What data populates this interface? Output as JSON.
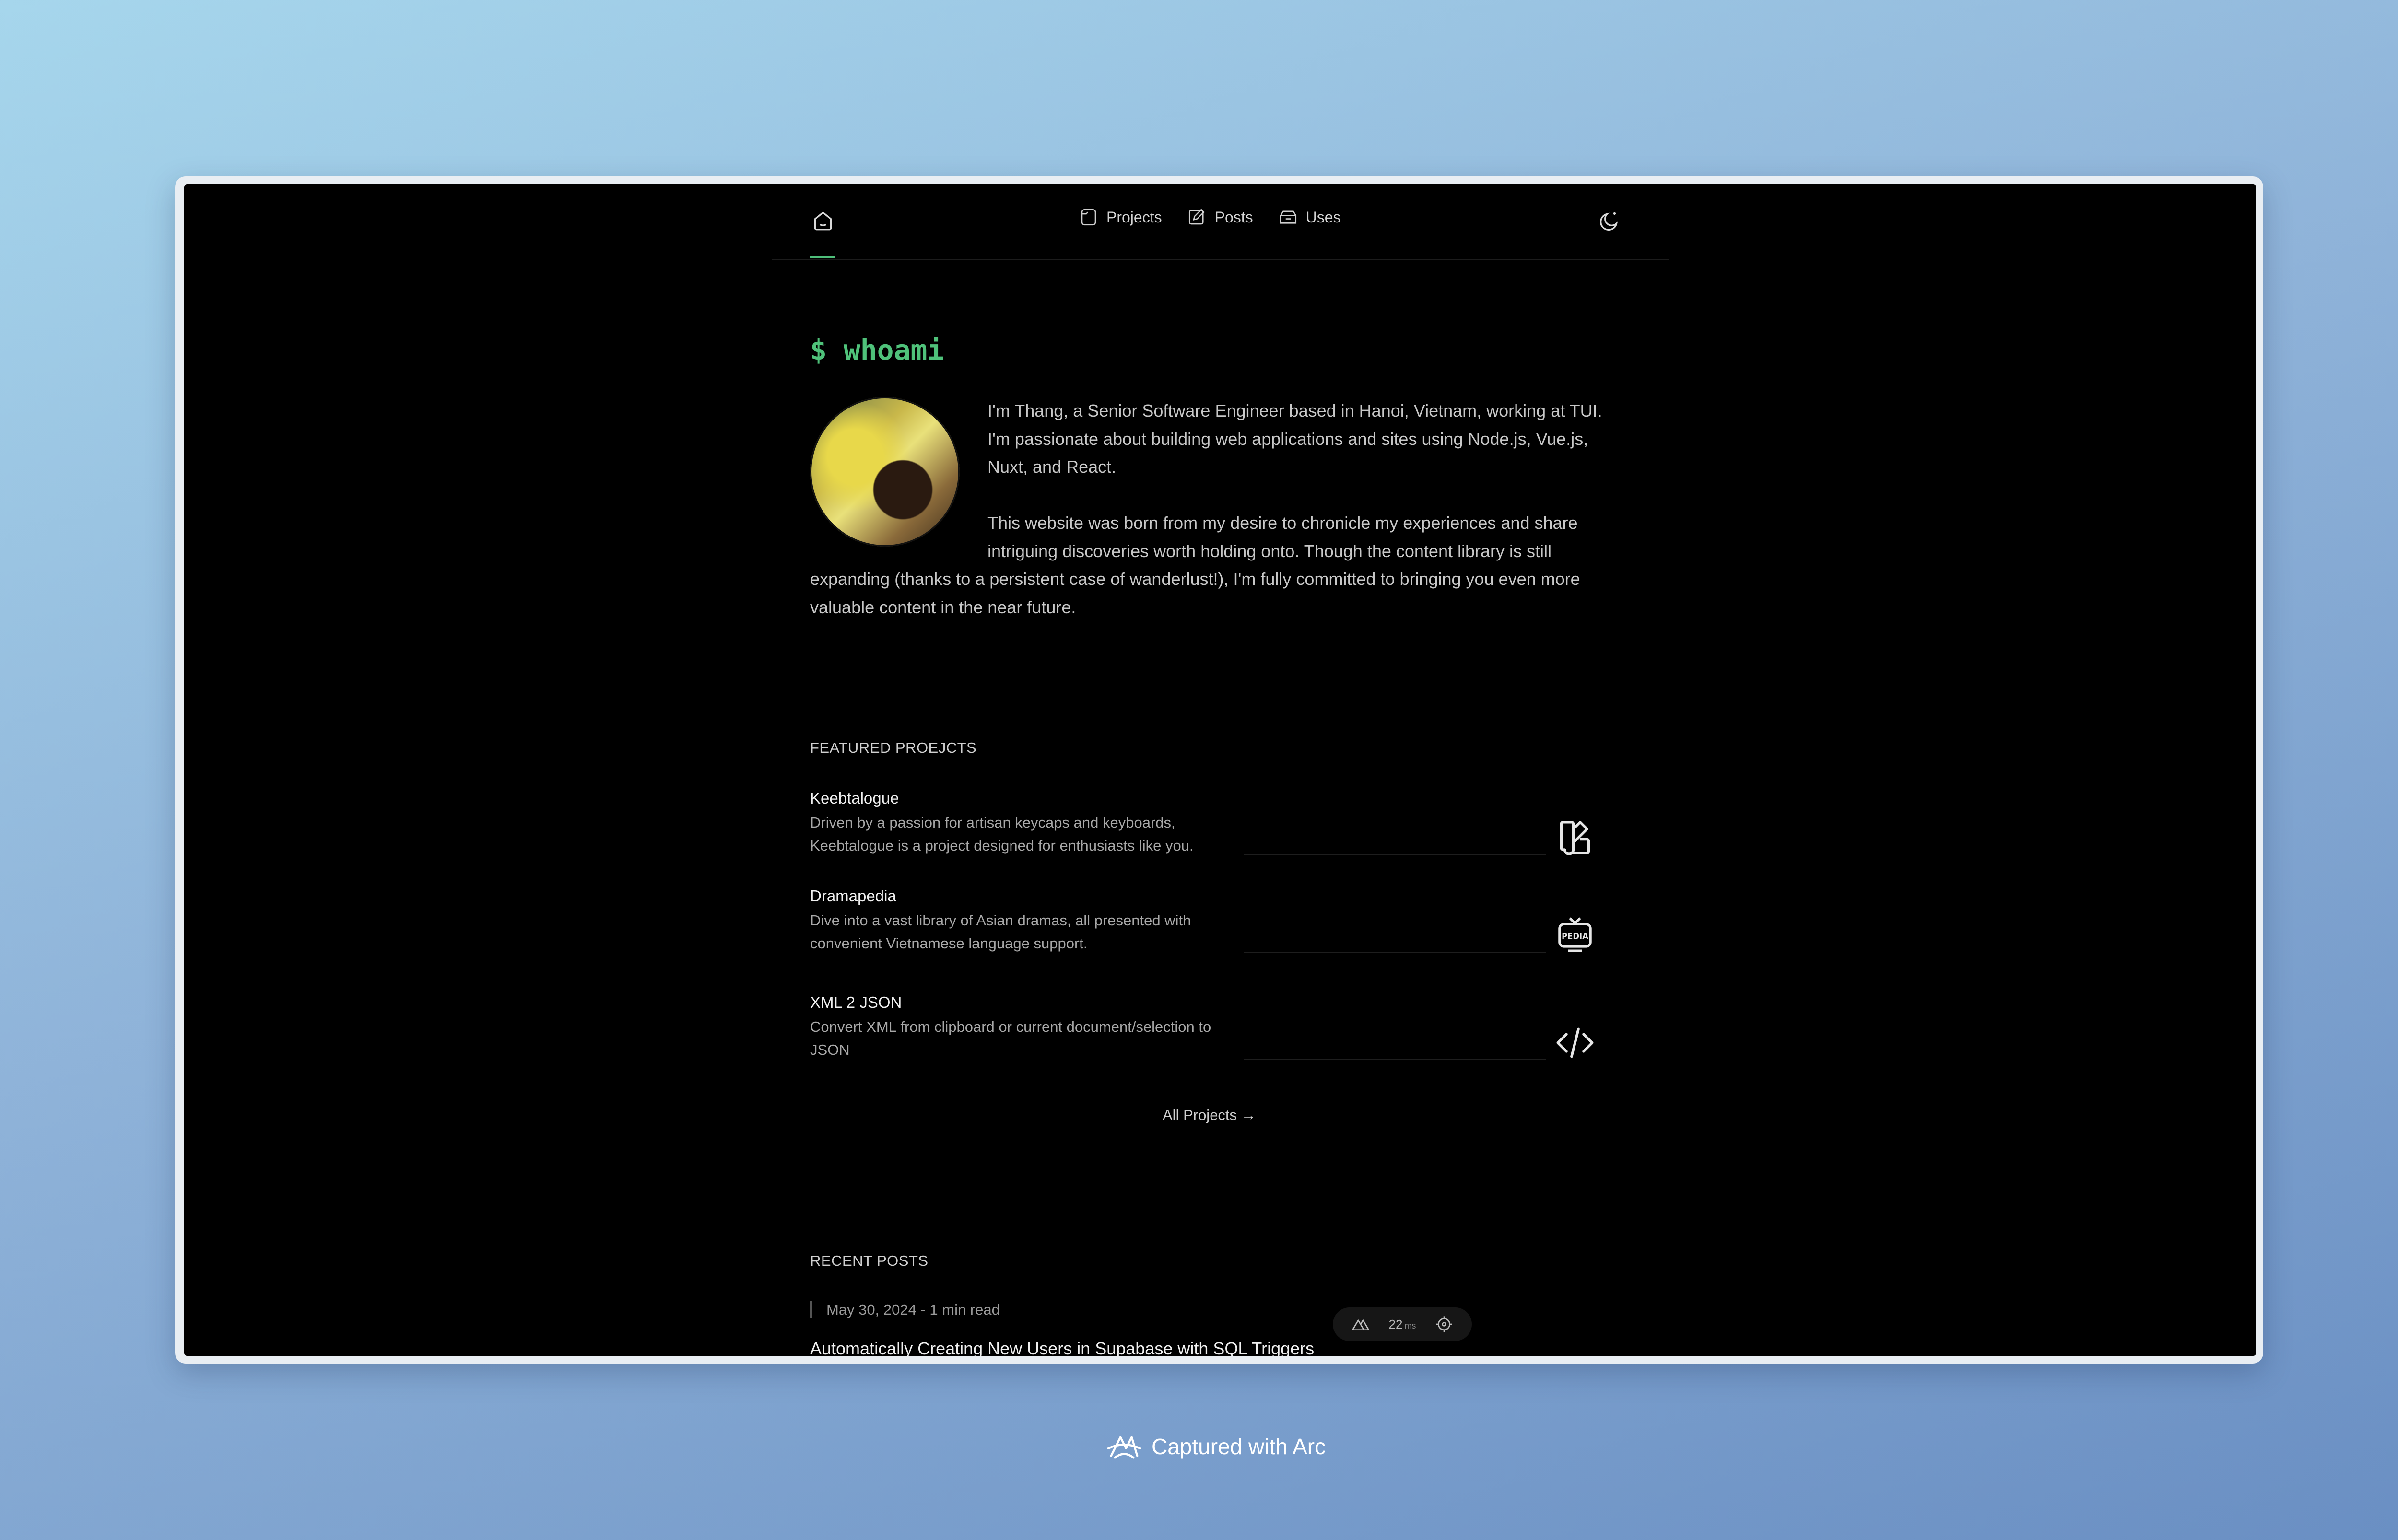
{
  "nav": {
    "links": [
      {
        "label": "Projects",
        "icon": "folder-icon"
      },
      {
        "label": "Posts",
        "icon": "edit-icon"
      },
      {
        "label": "Uses",
        "icon": "package-icon"
      }
    ]
  },
  "hero": {
    "title": "$ whoami",
    "paragraph_1": "I'm Thang, a Senior Software Engineer based in Hanoi, Vietnam, working at TUI. I'm passionate about building web applications and sites using Node.js, Vue.js, Nuxt, and React.",
    "paragraph_2": "This website was born from my desire to chronicle my experiences and share intriguing discoveries worth holding onto. Though the content library is still expanding (thanks to a persistent case of wanderlust!), I'm fully committed to bringing you even more valuable content in the near future."
  },
  "featured": {
    "heading": "FEATURED PROEJCTS",
    "projects": [
      {
        "title": "Keebtalogue",
        "description": "Driven by a passion for artisan keycaps and keyboards, Keebtalogue is a project designed for enthusiasts like you.",
        "icon": "swatch-book-icon"
      },
      {
        "title": "Dramapedia",
        "description": "Dive into a vast library of Asian dramas, all presented with convenient Vietnamese language support.",
        "icon": "tv-pedia-icon",
        "icon_text": "PEDIA"
      },
      {
        "title": "XML 2 JSON",
        "description": "Convert XML from clipboard or current document/selection to JSON",
        "icon": "code-icon"
      }
    ],
    "all_link": "All Projects →"
  },
  "recent": {
    "heading": "RECENT POSTS",
    "posts": [
      {
        "meta": "May 30, 2024 - 1 min read",
        "title": "Automatically Creating New Users in Supabase with SQL Triggers"
      }
    ]
  },
  "devtools": {
    "value": "22",
    "unit": "ms"
  },
  "footer": {
    "caption": "Captured with Arc"
  },
  "colors": {
    "accent": "#4fc27a",
    "background": "#000000"
  }
}
